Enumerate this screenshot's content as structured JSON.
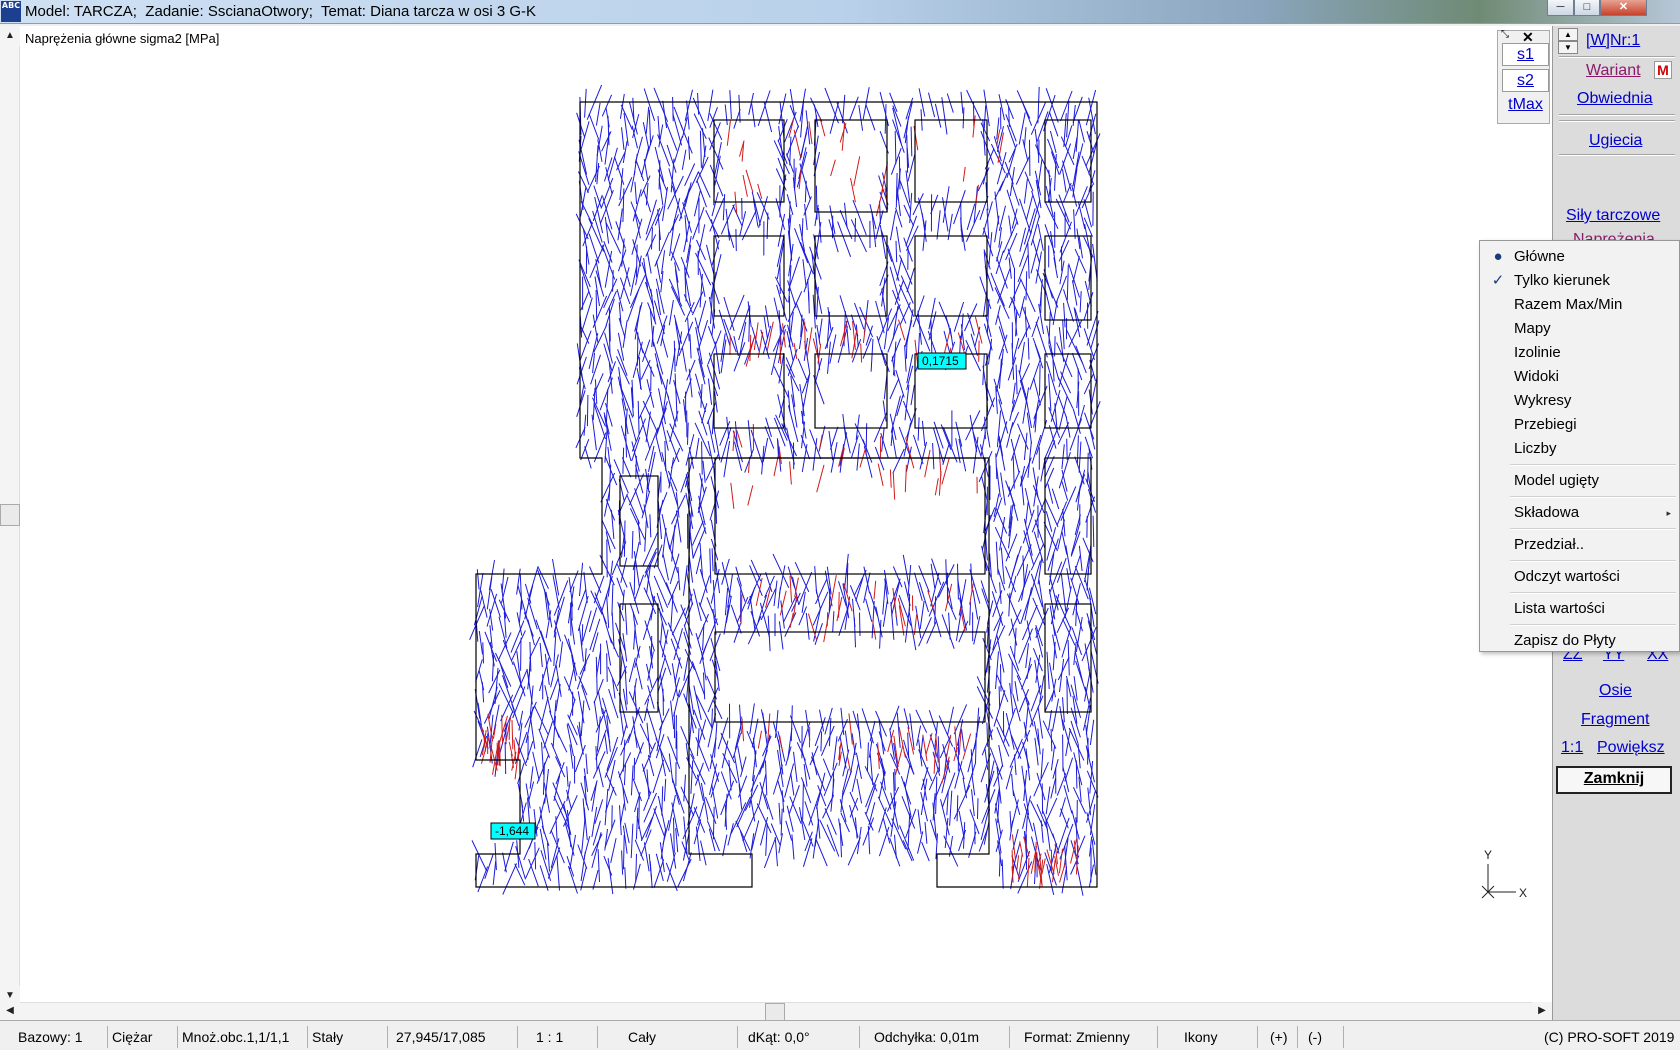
{
  "window": {
    "title": "Model: TARCZA;  Zadanie: SscianaOtwory;  Temat: Diana tarcza w osi 3 G-K",
    "app_icon": "ABC",
    "min_label": "─",
    "max_label": "□",
    "close_label": "✕"
  },
  "view": {
    "title": "Naprężenia główne sigma2 [MPa]",
    "label_max": "0,1715",
    "label_min": "-1,644",
    "axis_y": "Y",
    "axis_x": "X",
    "colors": {
      "compression": "#1a1adb",
      "tension": "#d21a1a",
      "outline": "#000000",
      "label_bg": "#00ffff"
    }
  },
  "variant_toggle": {
    "close_icon": "✕",
    "buttons": [
      "s1",
      "s2",
      "tMax"
    ]
  },
  "right_panel": {
    "w_nr": "[W]Nr:1",
    "wariant": "Wariant",
    "m_badge": "M",
    "obwiednia": "Obwiednia",
    "ugiecia": "Ugiecia",
    "sily_tarczowe": "Siły tarczowe",
    "naprezenia": "Naprężenia",
    "zz": "ZZ",
    "yy": "YY",
    "xx": "XX",
    "osie": "Osie",
    "fragment": "Fragment",
    "one_to_one": "1:1",
    "powieksz": "Powiększ",
    "zamknij": "Zamknij"
  },
  "context_menu": {
    "items": [
      {
        "label": "Główne",
        "mark": "●"
      },
      {
        "label": "Tylko kierunek",
        "mark": "✓"
      },
      {
        "label": "Razem Max/Min",
        "mark": ""
      },
      {
        "label": "Mapy",
        "mark": ""
      },
      {
        "label": "Izolinie",
        "mark": ""
      },
      {
        "label": "Widoki",
        "mark": ""
      },
      {
        "label": "Wykresy",
        "mark": ""
      },
      {
        "label": "Przebiegi",
        "mark": ""
      },
      {
        "label": "Liczby",
        "mark": ""
      },
      {
        "label": "Model ugięty",
        "mark": ""
      },
      {
        "label": "Składowa",
        "mark": "",
        "submenu": "▸"
      },
      {
        "label": "Przedział..",
        "mark": ""
      },
      {
        "label": "Odczyt wartości",
        "mark": ""
      },
      {
        "label": "Lista wartości",
        "mark": ""
      },
      {
        "label": "Zapisz do Płyty",
        "mark": ""
      }
    ]
  },
  "status_bar": {
    "bazowy": "Bazowy: 1",
    "ciezar": "Ciężar",
    "mnoz": "Mnoż.obc.1,1/1,1",
    "staly": "Stały",
    "coords": "27,945/17,085",
    "scale": "1 : 1",
    "caly": "Cały",
    "dkat": "dKąt: 0,0°",
    "odchylka": "Odchyłka: 0,01m",
    "format": "Format: Zmienny",
    "ikony": "Ikony",
    "plus": "(+)",
    "minus": "(-)",
    "copyright": "(C) PRO-SOFT 2019"
  }
}
